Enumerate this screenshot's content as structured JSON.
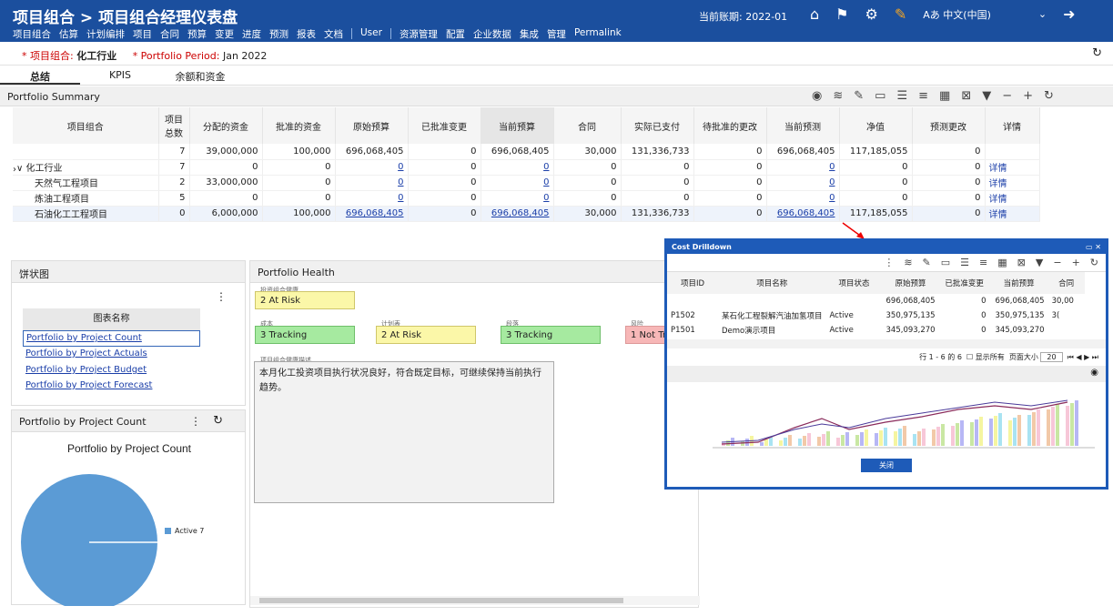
{
  "topbar": {
    "title": "项目组合 > 项目组合经理仪表盘",
    "menu": [
      "项目组合",
      "估算",
      "计划编排",
      "项目",
      "合同",
      "预算",
      "变更",
      "进度",
      "预测",
      "报表",
      "文档",
      "User",
      "资源管理",
      "配置",
      "企业数据",
      "集成",
      "管理",
      "Permalink"
    ],
    "period": "当前账期: 2022-01",
    "lang": "中文(中国)",
    "lang_icon": "Aあ"
  },
  "sub": {
    "portfolio_label": "* 项目组合:",
    "portfolio": "化工行业",
    "period_label": "* Portfolio Period:",
    "period": "Jan 2022"
  },
  "tabs": [
    "总结",
    "KPIS",
    "余额和资金"
  ],
  "summary": {
    "title": "Portfolio Summary"
  },
  "grid": {
    "headers": [
      "项目组合",
      "项目总数",
      "分配的资金",
      "批准的资金",
      "原始预算",
      "已批准变更",
      "当前预算",
      "合同",
      "实际已支付",
      "待批准的更改",
      "当前预测",
      "净值",
      "预测更改",
      "详情"
    ],
    "rows": [
      [
        "",
        "7",
        "39,000,000",
        "100,000",
        "696,068,405",
        "0",
        "696,068,405",
        "30,000",
        "131,336,733",
        "0",
        "696,068,405",
        "117,185,055",
        "0",
        ""
      ],
      [
        "∨ 化工行业",
        "7",
        "0",
        "0",
        "0",
        "0",
        "0",
        "0",
        "0",
        "0",
        "0",
        "0",
        "0",
        "详情"
      ],
      [
        "天然气工程项目",
        "2",
        "33,000,000",
        "0",
        "0",
        "0",
        "0",
        "0",
        "0",
        "0",
        "0",
        "0",
        "0",
        "详情"
      ],
      [
        "炼油工程项目",
        "5",
        "0",
        "0",
        "0",
        "0",
        "0",
        "0",
        "0",
        "0",
        "0",
        "0",
        "0",
        "详情"
      ],
      [
        "石油化工工程项目",
        "0",
        "6,000,000",
        "100,000",
        "696,068,405",
        "0",
        "696,068,405",
        "30,000",
        "131,336,733",
        "0",
        "696,068,405",
        "117,185,055",
        "0",
        "详情"
      ]
    ]
  },
  "pie": {
    "title": "饼状图",
    "col": "图表名称",
    "items": [
      "Portfolio by Project Count",
      "Portfolio by Project Actuals",
      "Portfolio by Project Budget",
      "Portfolio by Project Forecast"
    ]
  },
  "count": {
    "header": "Portfolio by Project Count",
    "chart_title": "Portfolio by Project Count",
    "legend": "Active 7"
  },
  "chart_data": {
    "type": "pie",
    "title": "Portfolio by Project Count",
    "categories": [
      "Active"
    ],
    "values": [
      7
    ],
    "colors": [
      "#5b9bd5"
    ]
  },
  "health": {
    "title": "Portfolio Health",
    "overall_label": "投资组合健康",
    "overall": "2 At Risk",
    "cost_label": "成本",
    "cost": "3 Tracking",
    "sched_label": "计划表",
    "sched": "2 At Risk",
    "scope_label": "段落",
    "scope": "3 Tracking",
    "risk_label": "风险",
    "risk": "1 Not Tra",
    "desc_label": "项目组合健康描述",
    "desc": "本月化工投资项目执行状况良好，符合既定目标，可继续保持当前执行趋势。"
  },
  "popup": {
    "title": "Cost Drilldown",
    "headers": [
      "项目ID",
      "项目名称",
      "项目状态",
      "原始预算",
      "已批准变更",
      "当前预算",
      "合同"
    ],
    "rows": [
      [
        "",
        "",
        "",
        "696,068,405",
        "0",
        "696,068,405",
        "30,00"
      ],
      [
        "P1502",
        "某石化工程裂解汽油加氢项目",
        "Active",
        "350,975,135",
        "0",
        "350,975,135",
        "3("
      ],
      [
        "P1501",
        "Demo演示项目",
        "Active",
        "345,093,270",
        "0",
        "345,093,270",
        ""
      ]
    ],
    "pager": "行 1 - 6 的 6",
    "show_all": "显示所有",
    "page_size_label": "页面大小",
    "page_size": "20",
    "close": "关闭"
  }
}
